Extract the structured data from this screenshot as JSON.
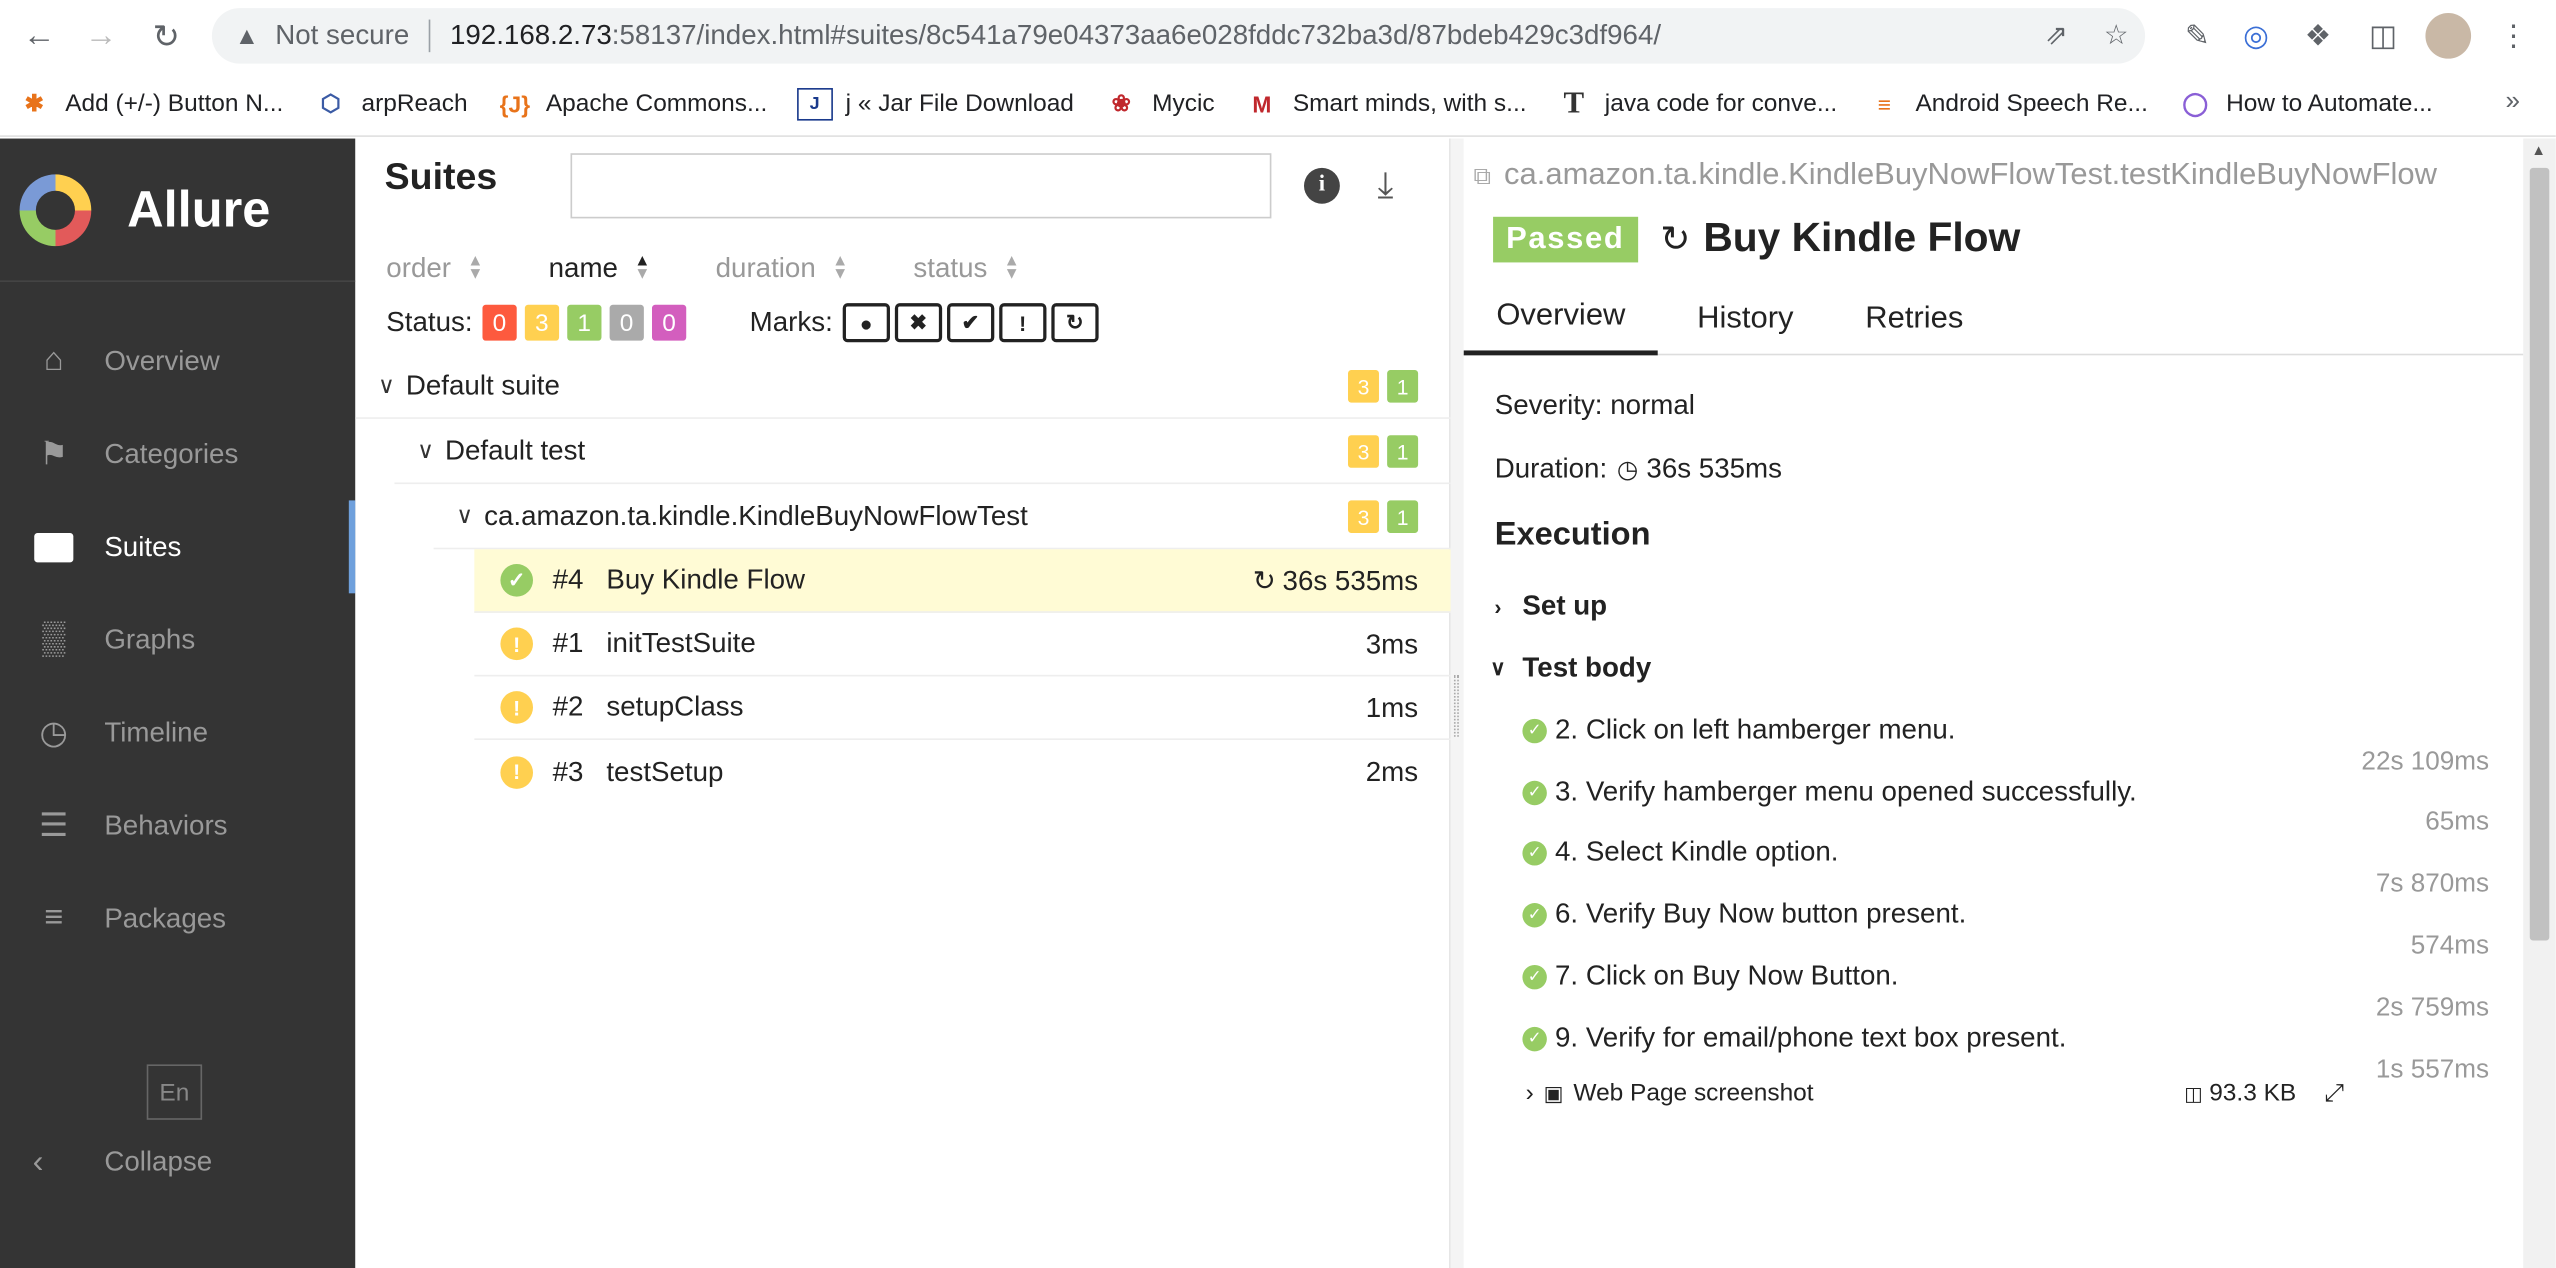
{
  "browser": {
    "security": "Not secure",
    "url_host": "192.168.2.73",
    "url_rest": ":58137/index.html#suites/8c541a79e04373aa6e028fddc732ba3d/87bdeb429c3df964/",
    "bookmarks": [
      {
        "label": "Add (+/-) Button N...",
        "icon": "asterisk-icon",
        "color": "#e8731a"
      },
      {
        "label": "arpReach",
        "icon": "hexagon-icon",
        "color": "#3b5ba5"
      },
      {
        "label": "Apache Commons...",
        "icon": "brackets-icon",
        "color": "#e8731a"
      },
      {
        "label": "j « Jar File Download",
        "icon": "jar-icon",
        "color": "#1a3a8c"
      },
      {
        "label": "Mycic",
        "icon": "maple-leaf-icon",
        "color": "#c0282d"
      },
      {
        "label": "Smart minds, with s...",
        "icon": "m-logo-icon",
        "color": "#c0282d"
      },
      {
        "label": "java code for conve...",
        "icon": "t-letter-icon",
        "color": "#333333"
      },
      {
        "label": "Android Speech Re...",
        "icon": "stack-icon",
        "color": "#e8731a"
      },
      {
        "label": "How to Automate...",
        "icon": "ring-icon",
        "color": "#8a5fd6"
      }
    ]
  },
  "sidebar": {
    "brand": "Allure",
    "items": [
      {
        "label": "Overview",
        "icon": "home-icon"
      },
      {
        "label": "Categories",
        "icon": "flag-icon"
      },
      {
        "label": "Suites",
        "icon": "briefcase-icon"
      },
      {
        "label": "Graphs",
        "icon": "bar-chart-icon"
      },
      {
        "label": "Timeline",
        "icon": "clock-icon"
      },
      {
        "label": "Behaviors",
        "icon": "list-icon"
      },
      {
        "label": "Packages",
        "icon": "align-left-icon"
      }
    ],
    "active": "Suites",
    "lang": "En",
    "collapse": "Collapse"
  },
  "suites": {
    "title": "Suites",
    "search_value": "",
    "sorts": [
      "order",
      "name",
      "duration",
      "status"
    ],
    "active_sort": "name",
    "status_label": "Status:",
    "status_counts": [
      {
        "value": "0",
        "color": "#fd5a3e"
      },
      {
        "value": "3",
        "color": "#ffd050"
      },
      {
        "value": "1",
        "color": "#97cc64"
      },
      {
        "value": "0",
        "color": "#aaaaaa"
      },
      {
        "value": "0",
        "color": "#d35ebe"
      }
    ],
    "marks_label": "Marks:",
    "marks": [
      "bomb-icon",
      "times-circle-icon",
      "check-circle-icon",
      "exclamation-circle-icon",
      "retry-icon"
    ],
    "tree": [
      {
        "label": "Default suite",
        "broken": "3",
        "passed": "1"
      },
      {
        "label": "Default test",
        "broken": "3",
        "passed": "1"
      },
      {
        "label": "ca.amazon.ta.kindle.KindleBuyNowFlowTest",
        "broken": "3",
        "passed": "1"
      }
    ],
    "tests": [
      {
        "num": "#4",
        "name": "Buy Kindle Flow",
        "duration": "36s 535ms",
        "status": "passed",
        "retried": true
      },
      {
        "num": "#1",
        "name": "initTestSuite",
        "duration": "3ms",
        "status": "broken",
        "retried": false
      },
      {
        "num": "#2",
        "name": "setupClass",
        "duration": "1ms",
        "status": "broken",
        "retried": false
      },
      {
        "num": "#3",
        "name": "testSetup",
        "duration": "2ms",
        "status": "broken",
        "retried": false
      }
    ]
  },
  "detail": {
    "full_name": "ca.amazon.ta.kindle.KindleBuyNowFlowTest.testKindleBuyNowFlow",
    "status": "Passed",
    "title": "Buy Kindle Flow",
    "tabs": [
      "Overview",
      "History",
      "Retries"
    ],
    "severity": "Severity: normal",
    "duration_label": "Duration:",
    "duration": "36s 535ms",
    "execution": "Execution",
    "setup": "Set up",
    "test_body": "Test body",
    "steps": [
      {
        "label": "2. Click on left hamberger menu.",
        "duration": "22s 109ms"
      },
      {
        "label": "3. Verify hamberger menu opened successfully.",
        "duration": "65ms"
      },
      {
        "label": "4. Select Kindle option.",
        "duration": "7s 870ms"
      },
      {
        "label": "6. Verify Buy Now button present.",
        "duration": "574ms"
      },
      {
        "label": "7. Click on Buy Now Button.",
        "duration": "2s 759ms"
      },
      {
        "label": "9. Verify for email/phone text box present.",
        "duration": "1s 557ms"
      }
    ],
    "attachment": {
      "name": "Web Page screenshot",
      "size": "93.3 KB"
    }
  }
}
